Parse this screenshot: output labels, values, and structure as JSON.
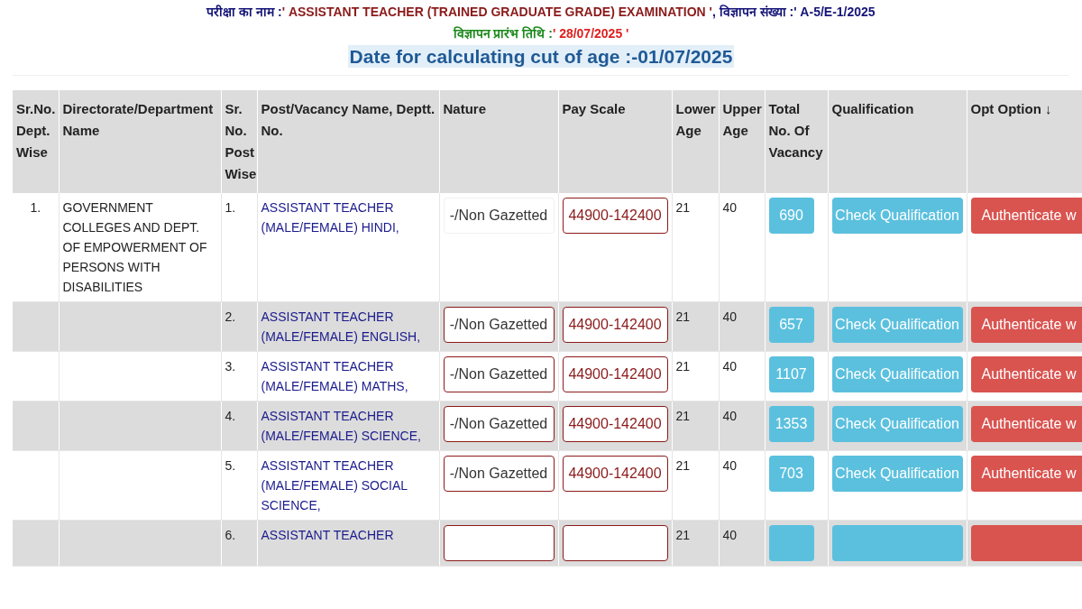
{
  "header": {
    "exam_label": "परीक्षा का नाम :",
    "exam_name": "' ASSISTANT TEACHER (TRAINED GRADUATE GRADE) EXAMINATION '",
    "ad_label": ", विज्ञापन संख्या :",
    "ad_no": "' A-5/E-1/2025",
    "start_label": "विज्ञापन प्रारंभ तिथि :",
    "start_date": "' 28/07/2025 '",
    "cutoff_text": "Date for calculating cut of age :-01/07/2025"
  },
  "columns": [
    "Sr.No. Dept. Wise",
    "Directorate/Department Name",
    "Sr. No. Post Wise",
    "Post/Vacancy Name, Deptt. No.",
    "Nature",
    "Pay Scale",
    "Lower Age",
    "Upper Age",
    "Total No. Of Vacancy",
    "Qualification",
    "Opt Option ↓"
  ],
  "rows": [
    {
      "sr": "1.",
      "dept": "GOVERNMENT COLLEGES AND DEPT. OF EMPOWERMENT OF PERSONS WITH DISABILITIES",
      "post_no": "1.",
      "post": "ASSISTANT TEACHER (MALE/FEMALE) HINDI,",
      "nature": "-/Non Gazetted",
      "nature_outlined": false,
      "pay": "44900-142400",
      "lower": "21",
      "upper": "40",
      "vacancy": "690",
      "check": "Check Qualification",
      "auth": "Authenticate w"
    },
    {
      "post_no": "2.",
      "post": "ASSISTANT TEACHER (MALE/FEMALE) ENGLISH,",
      "nature": "-/Non Gazetted",
      "nature_outlined": true,
      "pay": "44900-142400",
      "lower": "21",
      "upper": "40",
      "vacancy": "657",
      "check": "Check Qualification",
      "auth": "Authenticate w"
    },
    {
      "post_no": "3.",
      "post": "ASSISTANT TEACHER (MALE/FEMALE) MATHS,",
      "nature": "-/Non Gazetted",
      "nature_outlined": true,
      "pay": "44900-142400",
      "lower": "21",
      "upper": "40",
      "vacancy": "1107",
      "check": "Check Qualification",
      "auth": "Authenticate w"
    },
    {
      "post_no": "4.",
      "post": "ASSISTANT TEACHER (MALE/FEMALE) SCIENCE,",
      "nature": "-/Non Gazetted",
      "nature_outlined": true,
      "pay": "44900-142400",
      "lower": "21",
      "upper": "40",
      "vacancy": "1353",
      "check": "Check Qualification",
      "auth": "Authenticate w"
    },
    {
      "post_no": "5.",
      "post": "ASSISTANT TEACHER (MALE/FEMALE) SOCIAL SCIENCE,",
      "nature": "-/Non Gazetted",
      "nature_outlined": true,
      "pay": "44900-142400",
      "lower": "21",
      "upper": "40",
      "vacancy": "703",
      "check": "Check Qualification",
      "auth": "Authenticate w"
    },
    {
      "post_no": "6.",
      "post": "ASSISTANT TEACHER",
      "nature_outlined": true,
      "lower": "21",
      "upper": "40"
    }
  ]
}
